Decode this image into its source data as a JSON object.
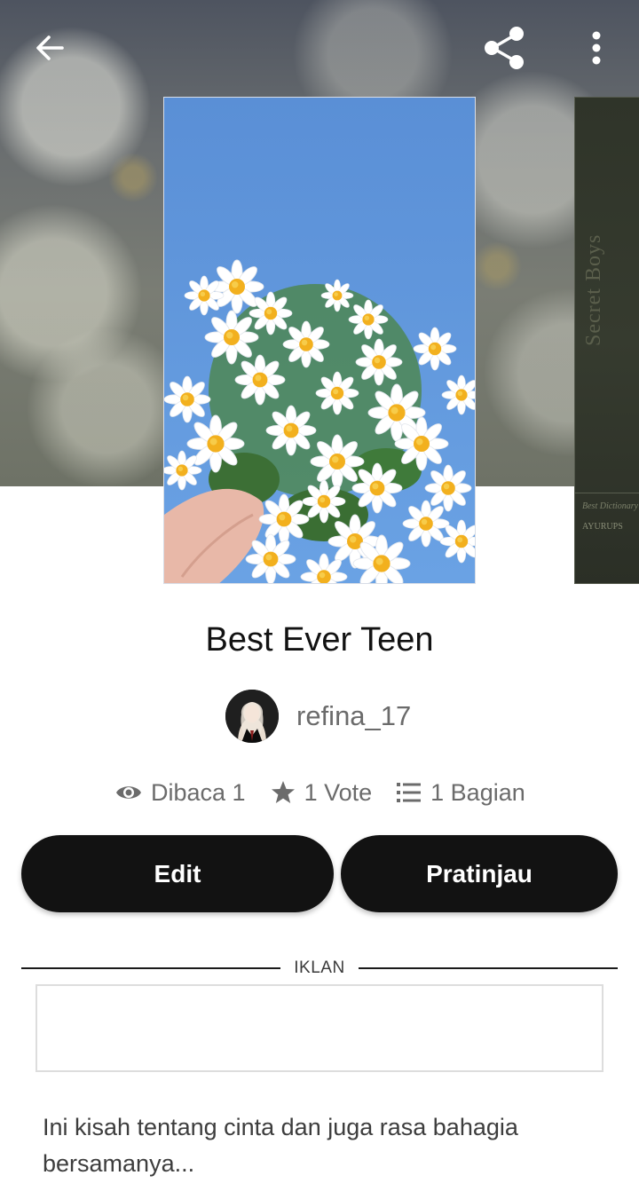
{
  "story": {
    "title": "Best Ever Teen",
    "author": "refina_17",
    "description": "Ini kisah tentang cinta dan juga rasa bahagia bersamanya..."
  },
  "stats": {
    "reads": "Dibaca 1",
    "votes": "1 Vote",
    "parts": "1 Bagian"
  },
  "actions": {
    "edit_label": "Edit",
    "preview_label": "Pratinjau"
  },
  "ad": {
    "label": "IKLAN"
  },
  "next_cover": {
    "title": "Secret Boys",
    "subtitle": "Best Dictionary",
    "author": "AYURUPS"
  },
  "icons": {
    "back": "arrow-left-icon",
    "share": "share-icon",
    "more": "more-vertical-icon",
    "reads": "eye-icon",
    "votes": "star-icon",
    "parts": "list-icon"
  },
  "colors": {
    "button_bg": "#121212",
    "button_text": "#ffffff",
    "muted_text": "#6b6b6b",
    "cover_sky": "#5f93d8"
  }
}
